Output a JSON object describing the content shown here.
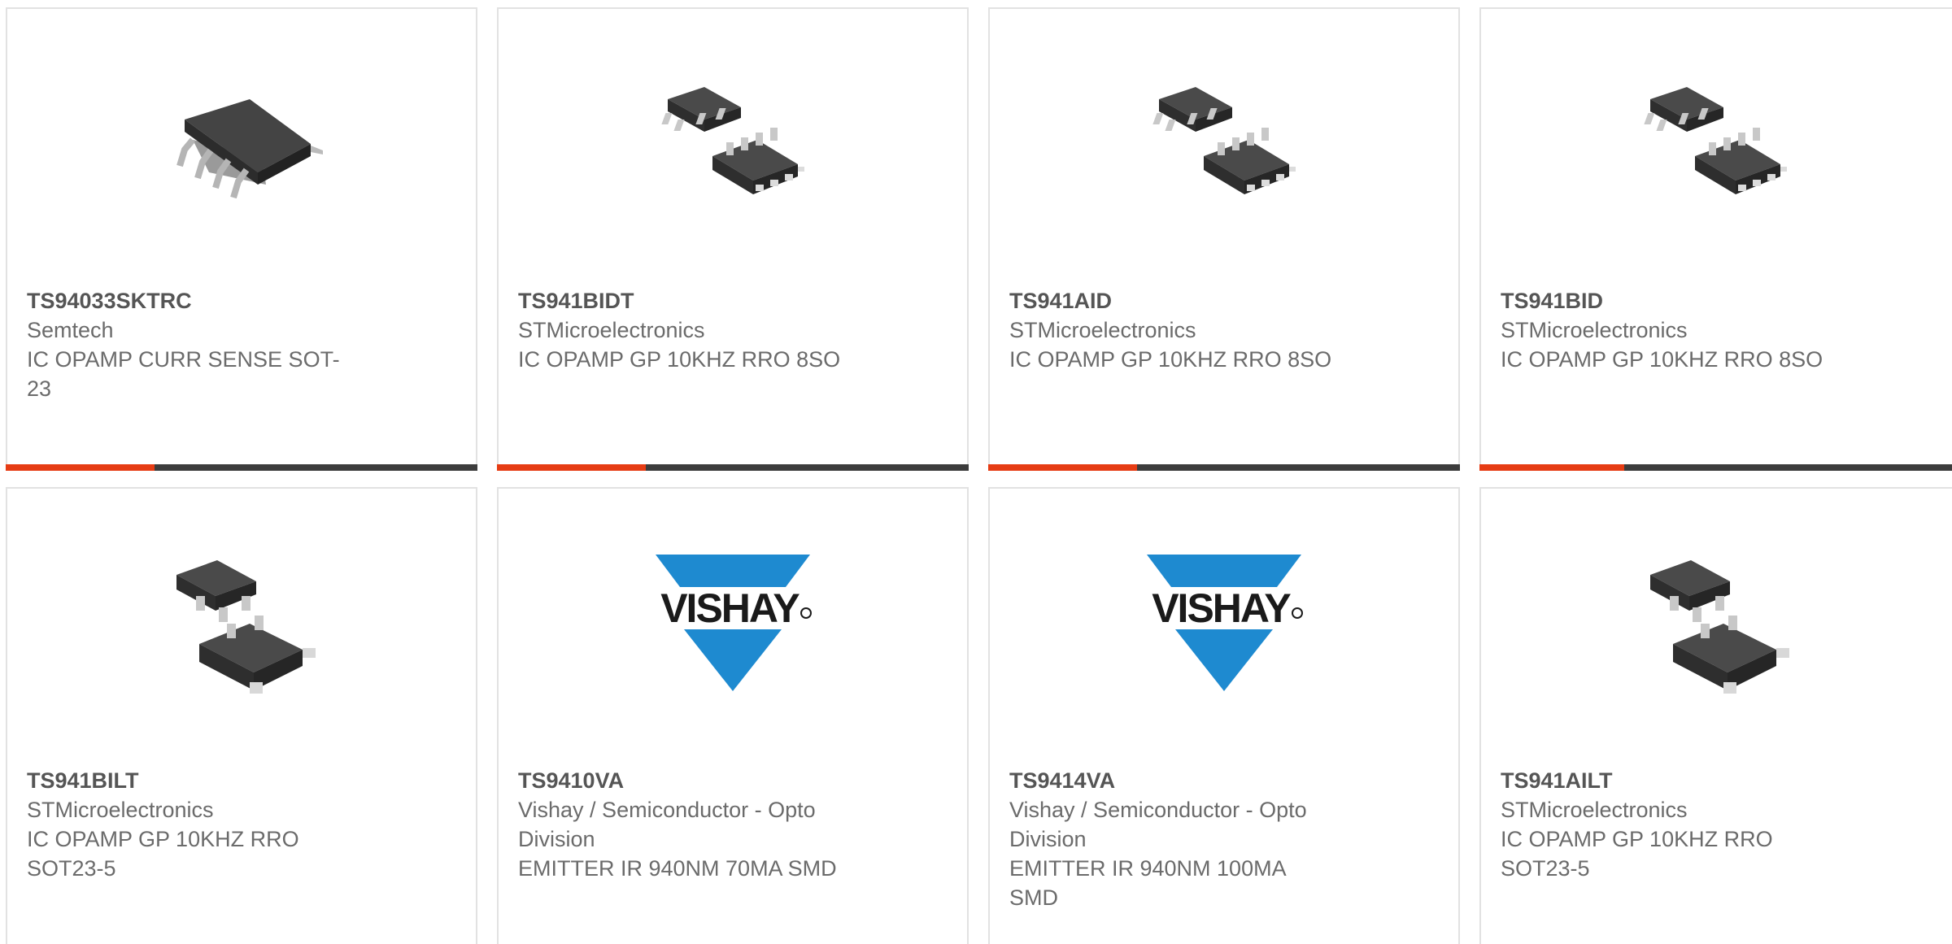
{
  "products": [
    {
      "part": "TS94033SKTRC",
      "maker": "Semtech",
      "desc": "IC OPAMP CURR SENSE SOT-23",
      "image": "sot23-6-chip-icon"
    },
    {
      "part": "TS941BIDT",
      "maker": "STMicroelectronics",
      "desc": "IC OPAMP GP 10KHZ RRO 8SO",
      "image": "so8-chip-icon"
    },
    {
      "part": "TS941AID",
      "maker": "STMicroelectronics",
      "desc": "IC OPAMP GP 10KHZ RRO 8SO",
      "image": "so8-chip-icon"
    },
    {
      "part": "TS941BID",
      "maker": "STMicroelectronics",
      "desc": "IC OPAMP GP 10KHZ RRO 8SO",
      "image": "so8-chip-icon"
    },
    {
      "part": "TS941BILT",
      "maker": "STMicroelectronics",
      "desc": "IC OPAMP GP 10KHZ RRO SOT23-5",
      "image": "sot23-5-chip-icon"
    },
    {
      "part": "TS9410VA",
      "maker": "Vishay / Semiconductor - Opto Division",
      "desc": "EMITTER IR 940NM 70MA SMD",
      "image": "vishay-logo"
    },
    {
      "part": "TS9414VA",
      "maker": "Vishay / Semiconductor - Opto Division",
      "desc": "EMITTER IR 940NM 100MA SMD",
      "image": "vishay-logo"
    },
    {
      "part": "TS941AILT",
      "maker": "STMicroelectronics",
      "desc": "IC OPAMP GP 10KHZ RRO SOT23-5",
      "image": "sot23-5-chip-icon"
    }
  ],
  "logo_text": "VISHAY",
  "colors": {
    "card_border": "#e2e2e2",
    "accent_bar": "#e63c14",
    "dark_bar": "#3c3c3c",
    "text": "#6b6b6b",
    "vishay_blue": "#1e8ad0"
  }
}
